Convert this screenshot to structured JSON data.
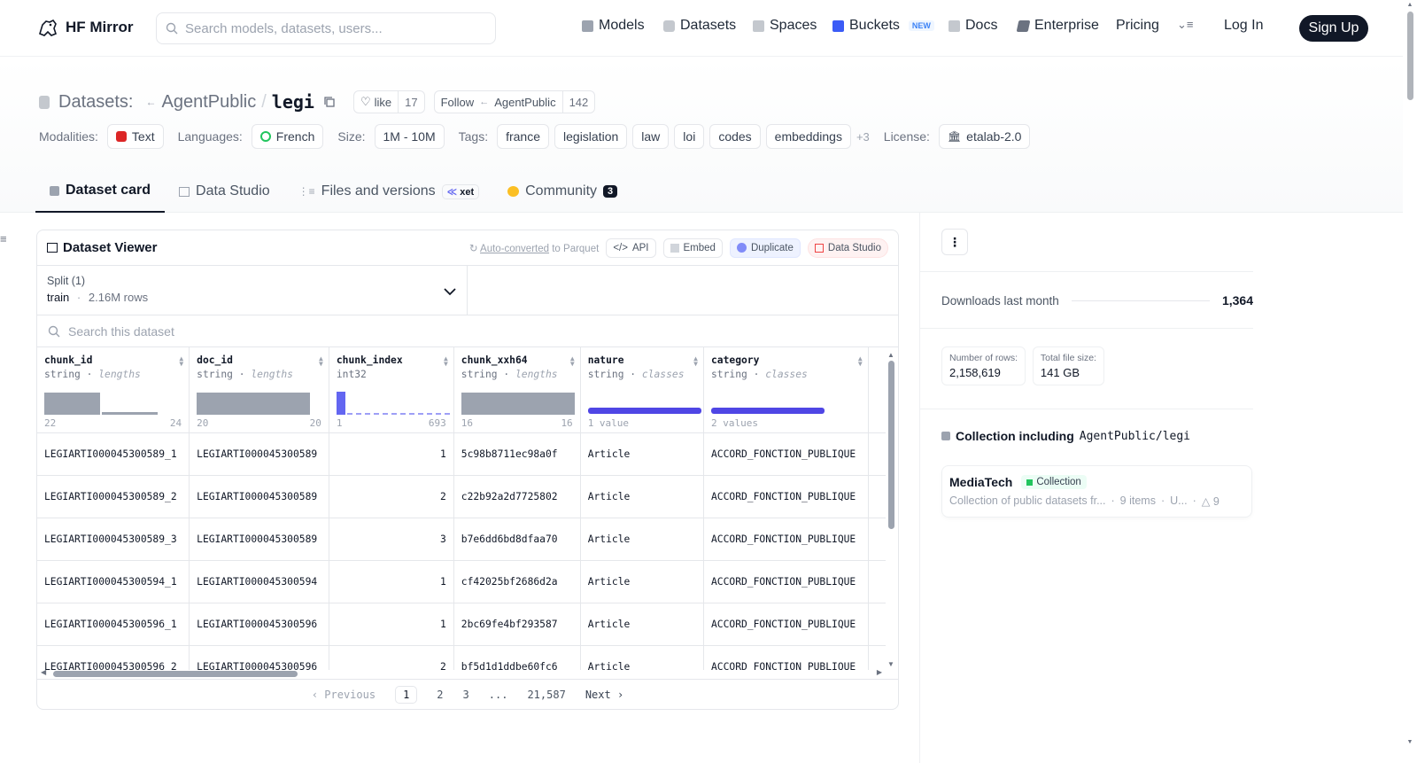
{
  "header": {
    "brand": "HF Mirror",
    "search_placeholder": "Search models, datasets, users...",
    "nav": [
      {
        "label": "Models",
        "icon": "cube-icon",
        "color": "#9ca3af"
      },
      {
        "label": "Datasets",
        "icon": "database-icon",
        "color": "#9ca3af"
      },
      {
        "label": "Spaces",
        "icon": "grid-icon",
        "color": "#9ca3af"
      },
      {
        "label": "Buckets",
        "icon": "bucket-icon",
        "color": "#3b5bf6"
      },
      {
        "label": "Docs",
        "icon": "book-icon",
        "color": "#9ca3af"
      },
      {
        "label": "Enterprise",
        "icon": "enterprise-icon",
        "color": "#6b7280"
      },
      {
        "label": "Pricing"
      }
    ],
    "buckets_badge": "NEW",
    "login": "Log In",
    "signup": "Sign Up"
  },
  "dataset": {
    "prefix": "Datasets:",
    "owner": "AgentPublic",
    "sep": "/",
    "name": "legi",
    "like_label": "like",
    "like_count": "17",
    "follow_label": "Follow",
    "follow_owner": "AgentPublic",
    "follow_count": "142"
  },
  "meta": {
    "modalities_label": "Modalities:",
    "modality": "Text",
    "languages_label": "Languages:",
    "language": "French",
    "size_label": "Size:",
    "size": "1M - 10M",
    "tags_label": "Tags:",
    "tags": [
      "france",
      "legislation",
      "law",
      "loi",
      "codes",
      "embeddings"
    ],
    "more_tags": "+3",
    "license_label": "License:",
    "license": "etalab-2.0"
  },
  "tabs": [
    {
      "label": "Dataset card",
      "active": true
    },
    {
      "label": "Data Studio"
    },
    {
      "label": "Files and versions",
      "badge": "xet"
    },
    {
      "label": "Community",
      "count": "3"
    }
  ],
  "viewer": {
    "title": "Dataset Viewer",
    "auto_converted": "Auto-converted",
    "to_parquet": "to Parquet",
    "api": "API",
    "embed": "Embed",
    "duplicate": "Duplicate",
    "data_studio": "Data Studio",
    "split_label": "Split (1)",
    "split_name": "train",
    "split_rows": "2.16M rows",
    "search_placeholder": "Search this dataset",
    "columns": [
      {
        "name": "chunk_id",
        "type": "string",
        "stat": "lengths",
        "min": "22",
        "max": "24"
      },
      {
        "name": "doc_id",
        "type": "string",
        "stat": "lengths",
        "min": "20",
        "max": "20"
      },
      {
        "name": "chunk_index",
        "type": "int32",
        "stat": "",
        "min": "1",
        "max": "693"
      },
      {
        "name": "chunk_xxh64",
        "type": "string",
        "stat": "lengths",
        "min": "16",
        "max": "16"
      },
      {
        "name": "nature",
        "type": "string",
        "stat": "classes",
        "min": "1 value",
        "max": ""
      },
      {
        "name": "category",
        "type": "string",
        "stat": "classes",
        "min": "2 values",
        "max": ""
      }
    ],
    "rows": [
      [
        "LEGIARTI000045300589_1",
        "LEGIARTI000045300589",
        "1",
        "5c98b8711ec98a0f",
        "Article",
        "ACCORD_FONCTION_PUBLIQUE"
      ],
      [
        "LEGIARTI000045300589_2",
        "LEGIARTI000045300589",
        "2",
        "c22b92a2d7725802",
        "Article",
        "ACCORD_FONCTION_PUBLIQUE"
      ],
      [
        "LEGIARTI000045300589_3",
        "LEGIARTI000045300589",
        "3",
        "b7e6dd6bd8dfaa70",
        "Article",
        "ACCORD_FONCTION_PUBLIQUE"
      ],
      [
        "LEGIARTI000045300594_1",
        "LEGIARTI000045300594",
        "1",
        "cf42025bf2686d2a",
        "Article",
        "ACCORD_FONCTION_PUBLIQUE"
      ],
      [
        "LEGIARTI000045300596_1",
        "LEGIARTI000045300596",
        "1",
        "2bc69fe4bf293587",
        "Article",
        "ACCORD_FONCTION_PUBLIQUE"
      ],
      [
        "LEGIARTI000045300596_2",
        "LEGIARTI000045300596",
        "2",
        "bf5d1d1ddbe60fc6",
        "Article",
        "ACCORD_FONCTION_PUBLIQUE"
      ]
    ],
    "pager": {
      "prev": "Previous",
      "pages": [
        "1",
        "2",
        "3",
        "...",
        "21,587"
      ],
      "next": "Next"
    }
  },
  "side": {
    "downloads_label": "Downloads last month",
    "downloads_value": "1,364",
    "rows_label": "Number of rows:",
    "rows_value": "2,158,619",
    "size_label": "Total file size:",
    "size_value": "141 GB",
    "collection_heading": "Collection including",
    "collection_repo": "AgentPublic/legi",
    "collection_name": "MediaTech",
    "collection_badge": "Collection",
    "collection_desc": "Collection of public datasets fr...",
    "collection_items": "9 items",
    "collection_updated": "U...",
    "collection_likes": "9"
  }
}
